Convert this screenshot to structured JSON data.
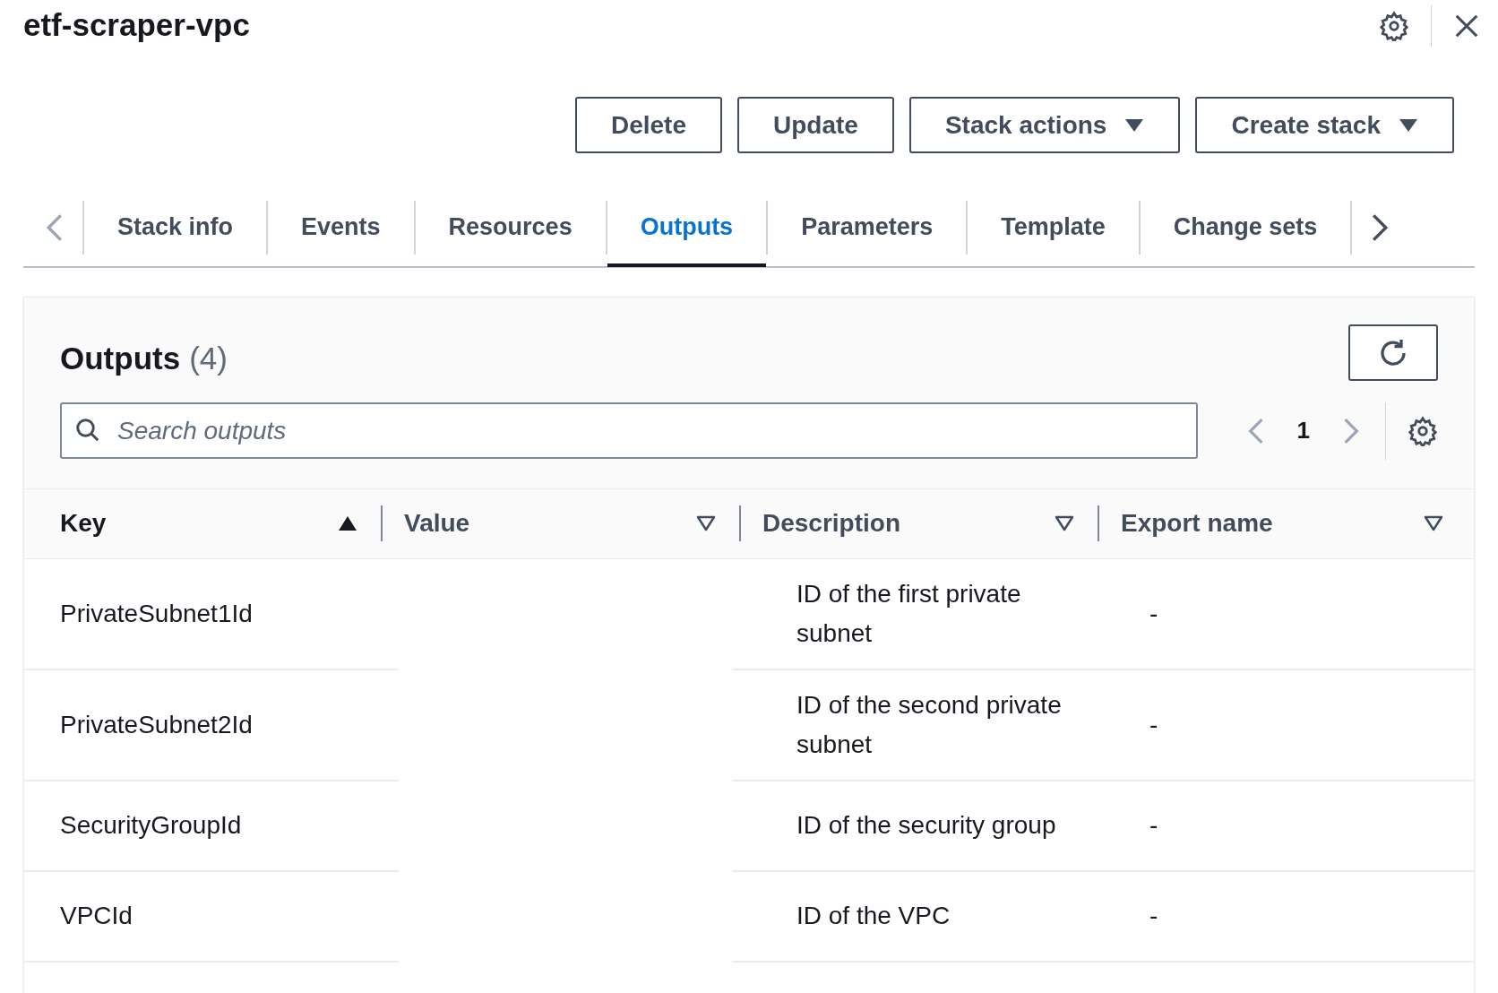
{
  "title": "etf-scraper-vpc",
  "header_buttons": [
    {
      "label": "Delete",
      "kind": "button"
    },
    {
      "label": "Update",
      "kind": "button"
    },
    {
      "label": "Stack actions",
      "kind": "dropdown"
    },
    {
      "label": "Create stack",
      "kind": "dropdown"
    }
  ],
  "tabs": [
    {
      "label": "Stack info",
      "selected": false
    },
    {
      "label": "Events",
      "selected": false
    },
    {
      "label": "Resources",
      "selected": false
    },
    {
      "label": "Outputs",
      "selected": true
    },
    {
      "label": "Parameters",
      "selected": false
    },
    {
      "label": "Template",
      "selected": false
    },
    {
      "label": "Change sets",
      "selected": false
    }
  ],
  "outputs": {
    "title": "Outputs",
    "count": "(4)",
    "search": {
      "placeholder": "Search outputs"
    },
    "page": "1",
    "columns": [
      {
        "label": "Key",
        "sorted": true
      },
      {
        "label": "Value",
        "sorted": false
      },
      {
        "label": "Description",
        "sorted": false
      },
      {
        "label": "Export name",
        "sorted": false
      }
    ],
    "rows": [
      {
        "key": "PrivateSubnet1Id",
        "description": "ID of the first private subnet",
        "export_name": "-"
      },
      {
        "key": "PrivateSubnet2Id",
        "description": "ID of the second private subnet",
        "export_name": "-"
      },
      {
        "key": "SecurityGroupId",
        "description": "ID of the security group",
        "export_name": "-"
      },
      {
        "key": "VPCId",
        "description": "ID of the VPC",
        "export_name": "-"
      }
    ]
  }
}
